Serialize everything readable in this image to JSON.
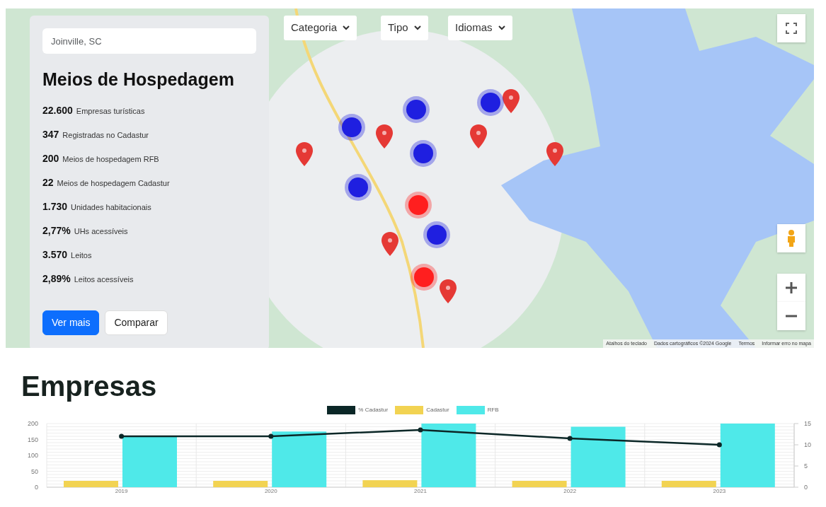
{
  "search": {
    "placeholder": "Joinville, SC"
  },
  "panel": {
    "title": "Meios de Hospedagem",
    "stats": [
      {
        "value": "22.600",
        "label": "Empresas turísticas"
      },
      {
        "value": "347",
        "label": "Registradas no Cadastur"
      },
      {
        "value": "200",
        "label": "Meios de hospedagem RFB"
      },
      {
        "value": "22",
        "label": "Meios de hospedagem Cadastur"
      },
      {
        "value": "1.730",
        "label": "Unidades habitacionais"
      },
      {
        "value": "2,77%",
        "label": "UHs acessíveis"
      },
      {
        "value": "3.570",
        "label": "Leitos"
      },
      {
        "value": "2,89%",
        "label": "Leitos acessíveis"
      }
    ],
    "buttons": [
      {
        "label": "Ver mais",
        "kind": "primary"
      },
      {
        "label": "Comparar",
        "kind": "secondary"
      }
    ]
  },
  "filters": [
    {
      "label": "Categoria"
    },
    {
      "label": "Tipo"
    },
    {
      "label": "Idiomas"
    }
  ],
  "map": {
    "markers": [
      {
        "kind": "pin",
        "color": "#e53935"
      },
      {
        "kind": "pin",
        "color": "#e53935"
      },
      {
        "kind": "pin",
        "color": "#e53935"
      },
      {
        "kind": "pin",
        "color": "#e53935"
      },
      {
        "kind": "pin",
        "color": "#e53935"
      },
      {
        "kind": "pin",
        "color": "#e53935"
      },
      {
        "kind": "pin",
        "color": "#e53935"
      },
      {
        "kind": "cluster",
        "color": "#ff1f1f"
      },
      {
        "kind": "cluster",
        "color": "#ff1f1f"
      },
      {
        "kind": "cluster",
        "color": "#1f1fe0"
      },
      {
        "kind": "cluster",
        "color": "#1f1fe0"
      },
      {
        "kind": "cluster",
        "color": "#1f1fe0"
      },
      {
        "kind": "cluster",
        "color": "#1f1fe0"
      },
      {
        "kind": "cluster",
        "color": "#1f1fe0"
      },
      {
        "kind": "cluster",
        "color": "#1f1fe0"
      }
    ],
    "footer": [
      "Atalhos do teclado",
      "Dados cartográficos ©2024 Google",
      "Termos",
      "Informar erro no mapa"
    ]
  },
  "section": {
    "title": "Empresas",
    "chart_data": {
      "type": "bar",
      "categories": [
        "2019",
        "2020",
        "2021",
        "2022",
        "2023"
      ],
      "series": [
        {
          "name": "% Cadastur",
          "type": "line",
          "axis": "y2",
          "marker": "circle",
          "color": "#0b2727",
          "values": [
            12,
            12,
            13.5,
            11.5,
            10
          ]
        },
        {
          "name": "Cadastur",
          "color": "#f2d352",
          "values": [
            20,
            20,
            22,
            20,
            20
          ]
        },
        {
          "name": "RFB",
          "color": "#4fe9e9",
          "values": [
            160,
            175,
            200,
            190,
            200
          ]
        }
      ],
      "stacked": false,
      "grid": true,
      "legend": "top",
      "ylim": [
        0,
        200
      ],
      "yticks": [
        0,
        50,
        100,
        150,
        200
      ],
      "y2lim": [
        0,
        15
      ],
      "y2ticks": [
        0,
        5,
        10,
        15
      ]
    }
  }
}
